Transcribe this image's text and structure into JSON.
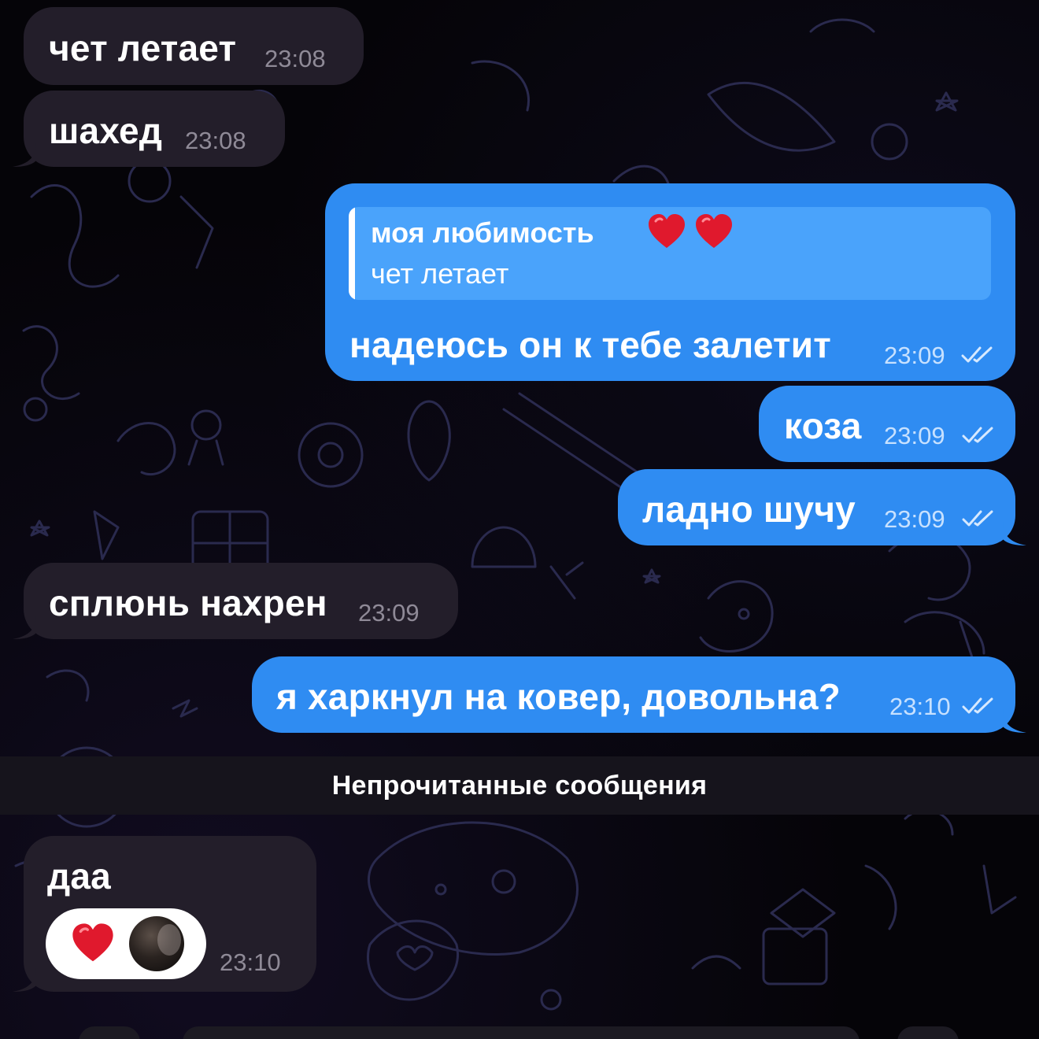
{
  "messages": [
    {
      "id": "m1",
      "direction": "incoming",
      "text": "чет летает",
      "time": "23:08"
    },
    {
      "id": "m2",
      "direction": "incoming",
      "text": "шахед",
      "time": "23:08"
    },
    {
      "id": "m3",
      "direction": "outgoing",
      "text": "надеюсь он к тебе залетит",
      "time": "23:09",
      "status": "read",
      "reply_to": {
        "sender": "моя любимость",
        "sender_emoji": [
          "red-heart-emoji",
          "red-heart-emoji"
        ],
        "text": "чет летает"
      }
    },
    {
      "id": "m4",
      "direction": "outgoing",
      "text": "коза",
      "time": "23:09",
      "status": "read"
    },
    {
      "id": "m5",
      "direction": "outgoing",
      "text": "ладно шучу",
      "time": "23:09",
      "status": "read"
    },
    {
      "id": "m6",
      "direction": "incoming",
      "text": "сплюнь нахрен",
      "time": "23:09"
    },
    {
      "id": "m7",
      "direction": "outgoing",
      "text": "я харкнул на ковер, довольна?",
      "time": "23:10",
      "status": "read"
    }
  ],
  "unread_divider": "Непрочитанные сообщения",
  "unread_messages": [
    {
      "id": "m8",
      "direction": "incoming",
      "text": "даа",
      "time": "23:10",
      "reaction": {
        "emoji": "red-heart-emoji",
        "reactor": "avatar"
      }
    }
  ],
  "colors": {
    "incoming_bubble": "#231e2a",
    "outgoing_bubble": "#2f8cf2",
    "reply_block": "#4aa3fb",
    "background": "#050408",
    "unread_bar": "#16141c",
    "heart": "#e0192d"
  }
}
